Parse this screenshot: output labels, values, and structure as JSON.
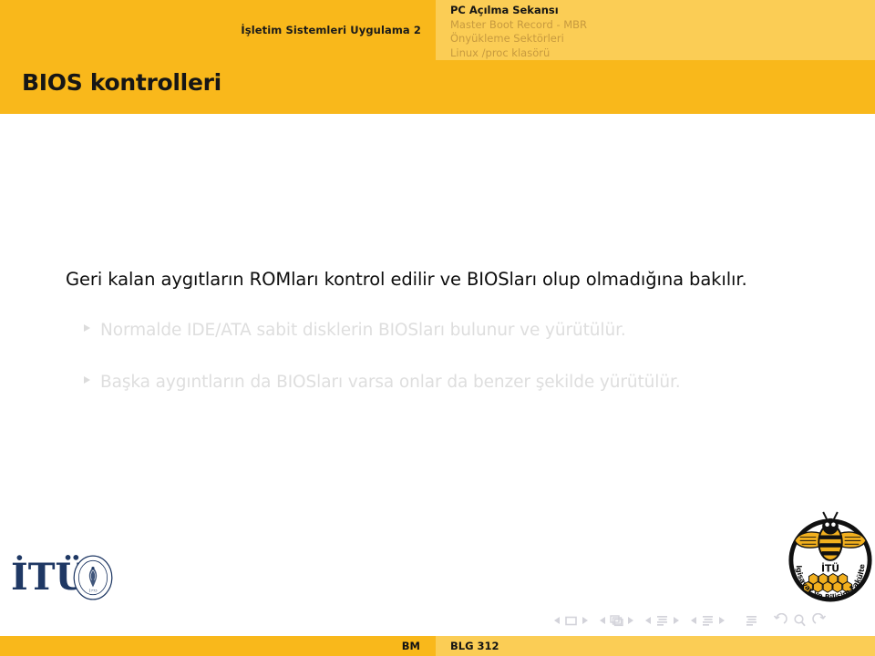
{
  "header": {
    "nav_title": "İşletim Sistemleri Uygulama 2",
    "sections": [
      {
        "label": "PC Açılma Sekansı",
        "active": true
      },
      {
        "label": "Master Boot Record - MBR",
        "active": false
      },
      {
        "label": "Önyükleme Sektörleri",
        "active": false
      },
      {
        "label": "Linux /proc klasörü",
        "active": false
      }
    ]
  },
  "frame": {
    "title": "BIOS kontrolleri",
    "lead_paragraph": "Geri kalan aygıtların ROMları kontrol edilir ve BIOSları olup olmadığına bakılır.",
    "bullets": [
      {
        "text": "Normalde IDE/ATA sabit disklerin BIOSları bulunur ve yürütülür."
      },
      {
        "text": "Başka aygıntların da BIOSları varsa onlar da benzer şekilde yürütülür."
      }
    ]
  },
  "logos": {
    "itu_wordmark": "İTÜ",
    "itu_seal_top_text": "ISTANBUL TECHNICAL UNIVERSITY",
    "itu_seal_year": "1773",
    "faculty_center_text": "İTÜ",
    "faculty_arc_text": "Bilgisayar ve Bilişim Fakültesi"
  },
  "navigation": {
    "groups": [
      {
        "icon": "slide-icon",
        "label": "slide"
      },
      {
        "icon": "frame-stack-icon",
        "label": "frame"
      },
      {
        "icon": "subsection-icon",
        "label": "subsection"
      },
      {
        "icon": "section-icon",
        "label": "section"
      }
    ],
    "document_icon": "document-icon",
    "misc": [
      {
        "icon": "back-arrow-icon"
      },
      {
        "icon": "search-icon"
      },
      {
        "icon": "forward-arrow-icon"
      }
    ]
  },
  "footer": {
    "author": "BM",
    "course": "BLG 312"
  },
  "colors": {
    "primary_orange": "#f9b81b",
    "light_orange": "#fbcd55",
    "title_text": "#161616",
    "dim_text": "#dedede",
    "section_inactive": "#c79a3f",
    "itu_navy": "#1f3864"
  }
}
